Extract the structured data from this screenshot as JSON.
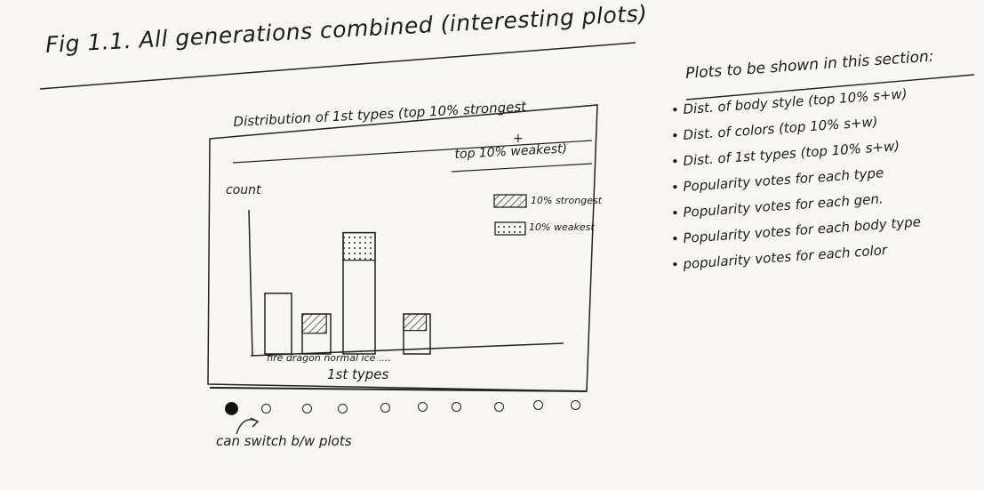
{
  "page_title": "Fig 1.1. All generations combined (interesting plots)",
  "chart": {
    "title_line1": "Distribution of 1st types (top 10% strongest",
    "title_plus": "+",
    "title_line2": "top 10% weakest)",
    "ylabel": "count",
    "xlabel": "1st types",
    "category_text": "fire dragon normal ice ....",
    "legend": {
      "strongest": "10% strongest",
      "weakest": "10% weakest"
    }
  },
  "chart_data": {
    "type": "bar",
    "title": "Distribution of 1st types (top 10% strongest + top 10% weakest)",
    "xlabel": "1st types",
    "ylabel": "count",
    "categories": [
      "fire",
      "dragon",
      "normal",
      "ice"
    ],
    "series": [
      {
        "name": "10% strongest",
        "values": [
          0,
          1.4,
          0,
          1.2
        ]
      },
      {
        "name": "10% weakest",
        "values": [
          0,
          0,
          2.0,
          0
        ]
      }
    ],
    "totals": [
      4.4,
      2.9,
      8.8,
      2.9
    ],
    "legend_position": "top-right"
  },
  "carousel": {
    "dot_count": 10,
    "active_index": 0,
    "note": "can switch b/w plots"
  },
  "side": {
    "heading": "Plots to be shown in this section:",
    "items": [
      "Dist. of body style (top 10% s+w)",
      "Dist. of colors (top 10% s+w)",
      "Dist. of 1st types (top 10% s+w)",
      "Popularity votes for each type",
      "Popularity votes for each gen.",
      "Popularity votes for each body type",
      "popularity votes for each color"
    ]
  }
}
